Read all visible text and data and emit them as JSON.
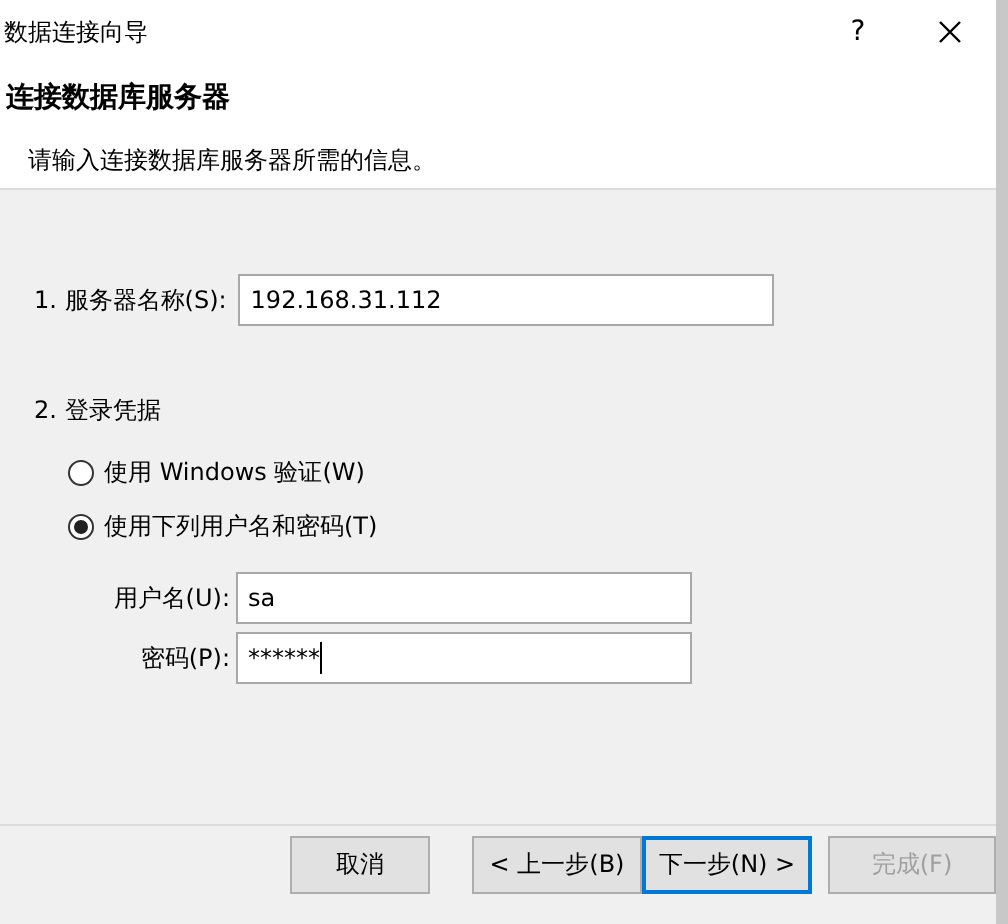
{
  "window": {
    "title": "数据连接向导",
    "help": "?"
  },
  "header": {
    "title": "连接数据库服务器",
    "subtitle": "请输入连接数据库服务器所需的信息。"
  },
  "server": {
    "label": "1. 服务器名称(S):",
    "value": "192.168.31.112"
  },
  "login": {
    "label": "2. 登录凭据",
    "options": [
      {
        "label": "使用 Windows 验证(W)",
        "selected": false
      },
      {
        "label": "使用下列用户名和密码(T)",
        "selected": true
      }
    ],
    "username": {
      "label": "用户名(U):",
      "value": "sa"
    },
    "password": {
      "label": "密码(P):",
      "value": "******"
    }
  },
  "buttons": [
    {
      "label": "取消",
      "default": false,
      "disabled": false
    },
    {
      "label": "< 上一步(B)",
      "default": false,
      "disabled": false
    },
    {
      "label": "下一步(N) >",
      "default": true,
      "disabled": false
    },
    {
      "label": "完成(F)",
      "default": false,
      "disabled": true
    }
  ]
}
